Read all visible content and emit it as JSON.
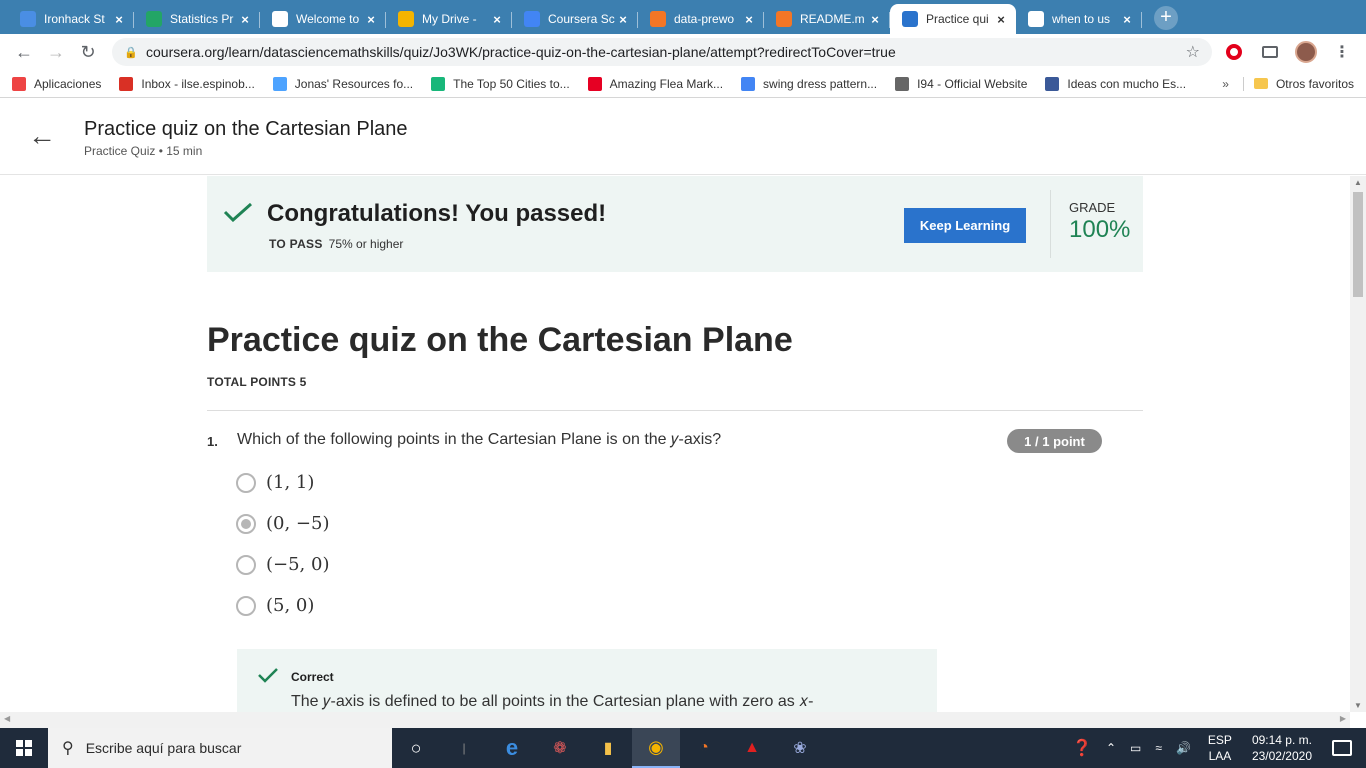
{
  "browser": {
    "tabs": [
      {
        "title": "Ironhack St",
        "favicon_color": "#4a8ee4",
        "active": false
      },
      {
        "title": "Statistics Pr",
        "favicon_color": "#23a566",
        "active": false
      },
      {
        "title": "Welcome to",
        "favicon_color": "#ffffff",
        "active": false
      },
      {
        "title": "My Drive -",
        "favicon_color": "#f4b400",
        "active": false
      },
      {
        "title": "Coursera Sc",
        "favicon_color": "#4285f4",
        "active": false
      },
      {
        "title": "data-prewo",
        "favicon_color": "#f37626",
        "active": false
      },
      {
        "title": "README.m",
        "favicon_color": "#f37626",
        "active": false
      },
      {
        "title": "Practice qui",
        "favicon_color": "#2a73cc",
        "active": true
      },
      {
        "title": "when to us",
        "favicon_color": "#ffffff",
        "active": false
      }
    ],
    "url": "coursera.org/learn/datasciencemathskills/quiz/Jo3WK/practice-quiz-on-the-cartesian-plane/attempt?redirectToCover=true",
    "bookmarks": [
      {
        "label": "Aplicaciones",
        "icon": "apps-grid-icon",
        "color": "#e44"
      },
      {
        "label": "Inbox - ilse.espinob...",
        "icon": "gmail-icon",
        "color": "#d93025"
      },
      {
        "label": "Jonas' Resources fo...",
        "icon": "heart-icon",
        "color": "#4da3ff"
      },
      {
        "label": "The Top 50 Cities to...",
        "icon": "flag-icon",
        "color": "#18b77a"
      },
      {
        "label": "Amazing Flea Mark...",
        "icon": "pinterest-icon",
        "color": "#e60023"
      },
      {
        "label": "swing dress pattern...",
        "icon": "google-icon",
        "color": "#4285f4"
      },
      {
        "label": "I94 - Official Website",
        "icon": "globe-icon",
        "color": "#666"
      },
      {
        "label": "Ideas con mucho Es...",
        "icon": "facebook-icon",
        "color": "#3b5998"
      }
    ],
    "bookmarks_more": "»",
    "other_bookmarks": "Otros favoritos"
  },
  "header": {
    "title": "Practice quiz on the Cartesian Plane",
    "subtitle": "Practice Quiz • 15 min"
  },
  "result": {
    "headline": "Congratulations! You passed!",
    "to_pass_label": "TO PASS",
    "to_pass_value": "75% or higher",
    "button": "Keep Learning",
    "grade_label": "GRADE",
    "grade_value": "100%"
  },
  "quiz": {
    "title": "Practice quiz on the Cartesian Plane",
    "total_points": "TOTAL POINTS 5",
    "question_number": "1.",
    "question_text": "Which of the following points in the Cartesian Plane is on the 𝑦-axis?",
    "points_badge": "1 / 1 point",
    "options": [
      {
        "label": "(1, 1)",
        "selected": false
      },
      {
        "label": "(0, −5)",
        "selected": true
      },
      {
        "label": "(−5, 0)",
        "selected": false
      },
      {
        "label": "(5, 0)",
        "selected": false
      }
    ],
    "feedback_title": "Correct",
    "feedback_text": "The 𝑦-axis is defined to be all points in the Cartesian plane with zero as 𝑥-"
  },
  "taskbar": {
    "search_placeholder": "Escribe aquí para buscar",
    "lang_top": "ESP",
    "lang_bottom": "LAA",
    "time": "09:14 p. m.",
    "date": "23/02/2020"
  }
}
